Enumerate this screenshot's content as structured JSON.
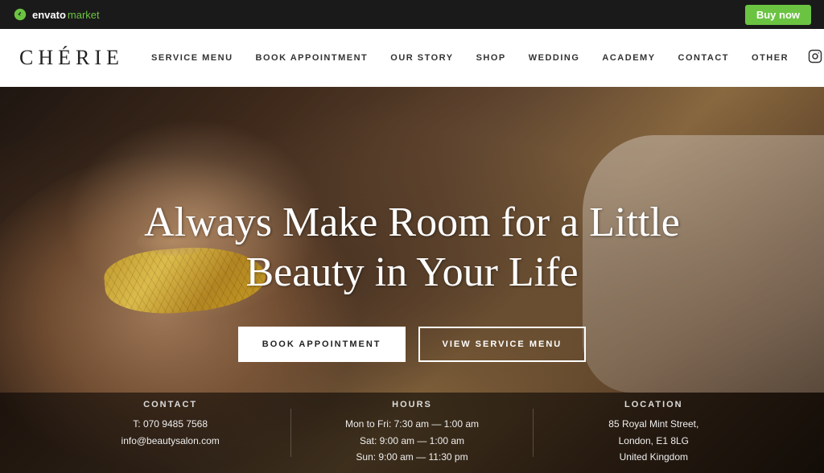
{
  "topbar": {
    "envato_text": "envato",
    "market_text": "market",
    "buy_now": "Buy now"
  },
  "nav": {
    "logo": "CHÉRIE",
    "items": [
      {
        "label": "SERVICE MENU"
      },
      {
        "label": "BOOK APPOINTMENT"
      },
      {
        "label": "OUR STORY"
      },
      {
        "label": "SHOP"
      },
      {
        "label": "WEDDING"
      },
      {
        "label": "ACADEMY"
      },
      {
        "label": "CONTACT"
      },
      {
        "label": "OTHER"
      }
    ]
  },
  "hero": {
    "title_line1": "Always Make Room for a Little",
    "title_line2": "Beauty in Your Life",
    "btn_book": "BOOK APPOINTMENT",
    "btn_service": "VIEW SERVICE MENU"
  },
  "infobar": {
    "contact": {
      "title": "CONTACT",
      "phone": "T: 070 9485 7568",
      "email": "info@beautysalon.com"
    },
    "hours": {
      "title": "HOURS",
      "line1": "Mon to Fri: 7:30 am — 1:00 am",
      "line2": "Sat: 9:00 am — 1:00 am",
      "line3": "Sun: 9:00 am — 11:30 pm"
    },
    "location": {
      "title": "LOCATION",
      "line1": "85 Royal Mint Street,",
      "line2": "London, E1 8LG",
      "line3": "United Kingdom"
    }
  }
}
